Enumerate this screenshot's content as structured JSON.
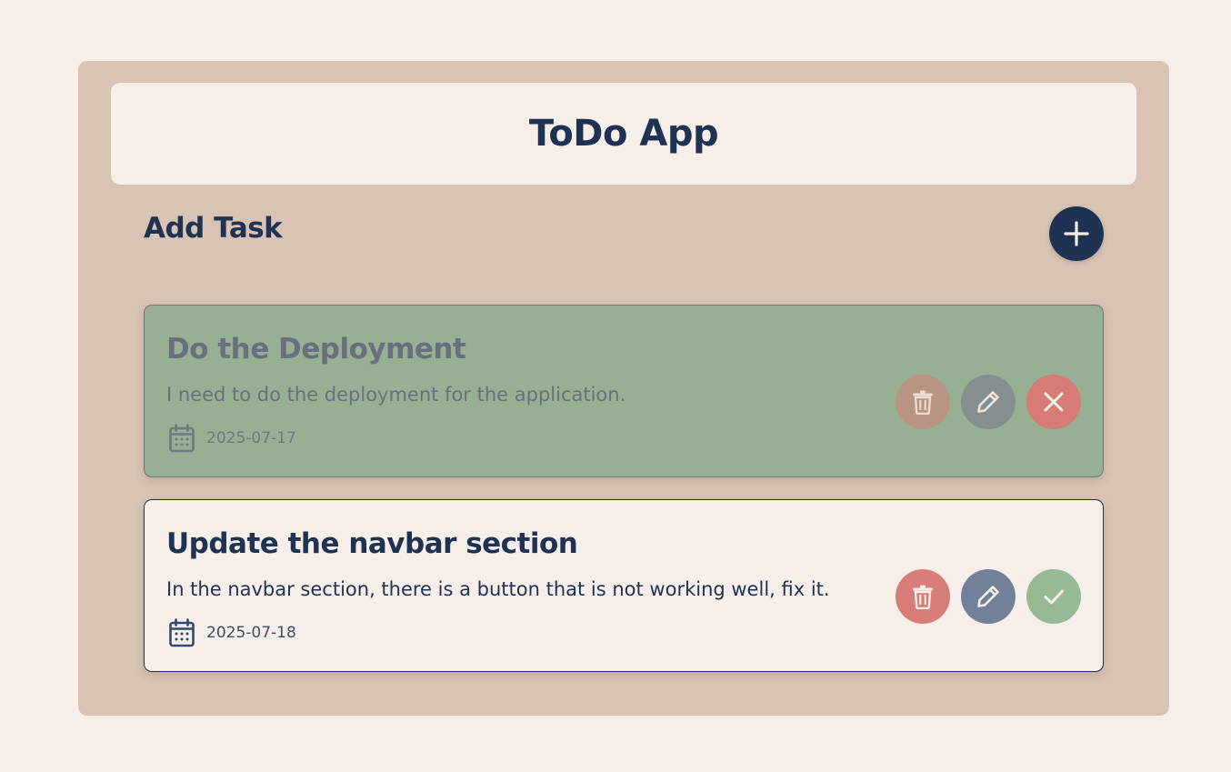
{
  "app": {
    "title": "ToDo App"
  },
  "add_task": {
    "title": "Add Task",
    "button_icon": "plus-icon"
  },
  "colors": {
    "page_bg": "#f6eee8",
    "panel_bg": "#d8c3b5",
    "primary": "#1f3252",
    "done_card_bg": "#97b093",
    "delete": "#d77c78",
    "edit": "#718199",
    "complete": "#97b995"
  },
  "tasks": [
    {
      "title": "Do the Deployment",
      "description": "I need to do the deployment for the application.",
      "date": "2025-07-17",
      "status": "completed",
      "actions": [
        "trash-icon",
        "pencil-icon",
        "close-icon"
      ]
    },
    {
      "title": "Update the navbar section",
      "description": "In the navbar section, there is a button that is not working well, fix it.",
      "date": "2025-07-18",
      "status": "pending",
      "actions": [
        "trash-icon",
        "pencil-icon",
        "check-icon"
      ]
    }
  ]
}
